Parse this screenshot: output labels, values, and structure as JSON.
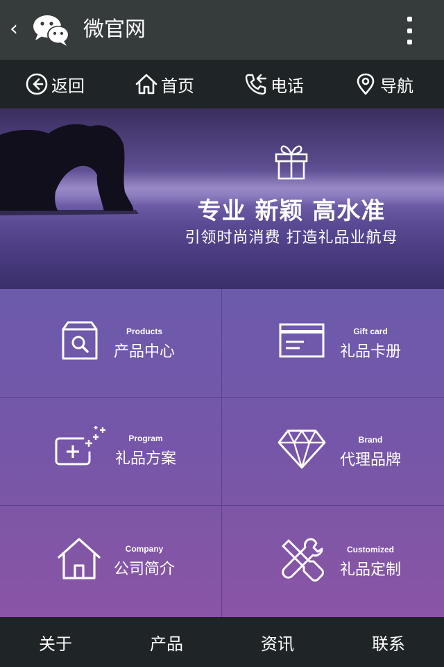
{
  "app": {
    "title": "微官网",
    "back_icon": "chevron-left-icon",
    "menu_icon": "more-vertical-icon",
    "logo_icon": "wechat-logo-icon"
  },
  "nav": {
    "items": [
      {
        "label": "返回",
        "icon": "arrow-left-circle-icon"
      },
      {
        "label": "首页",
        "icon": "home-icon"
      },
      {
        "label": "电话",
        "icon": "phone-icon"
      },
      {
        "label": "导航",
        "icon": "map-pin-icon"
      }
    ]
  },
  "banner": {
    "title": "专业 新颖 高水准",
    "subtitle": "引领时尚消费 打造礼品业航母",
    "icon": "gift-icon"
  },
  "grid": {
    "items": [
      {
        "en": "Products",
        "cn": "产品中心",
        "icon": "product-search-box-icon"
      },
      {
        "en": "Gift card",
        "cn": "礼品卡册",
        "icon": "card-icon"
      },
      {
        "en": "Program",
        "cn": "礼品方案",
        "icon": "add-sparkle-icon"
      },
      {
        "en": "Brand",
        "cn": "代理品牌",
        "icon": "diamond-icon"
      },
      {
        "en": "Company",
        "cn": "公司简介",
        "icon": "house-icon"
      },
      {
        "en": "Customized",
        "cn": "礼品定制",
        "icon": "tools-icon"
      }
    ]
  },
  "tabbar": {
    "items": [
      {
        "label": "关于"
      },
      {
        "label": "产品"
      },
      {
        "label": "资讯"
      },
      {
        "label": "联系"
      }
    ]
  },
  "colors": {
    "titlebar": "#363b3c",
    "navbar": "#1f2426",
    "grid_top": "#6c5aab",
    "grid_bottom": "#8a55a4"
  }
}
